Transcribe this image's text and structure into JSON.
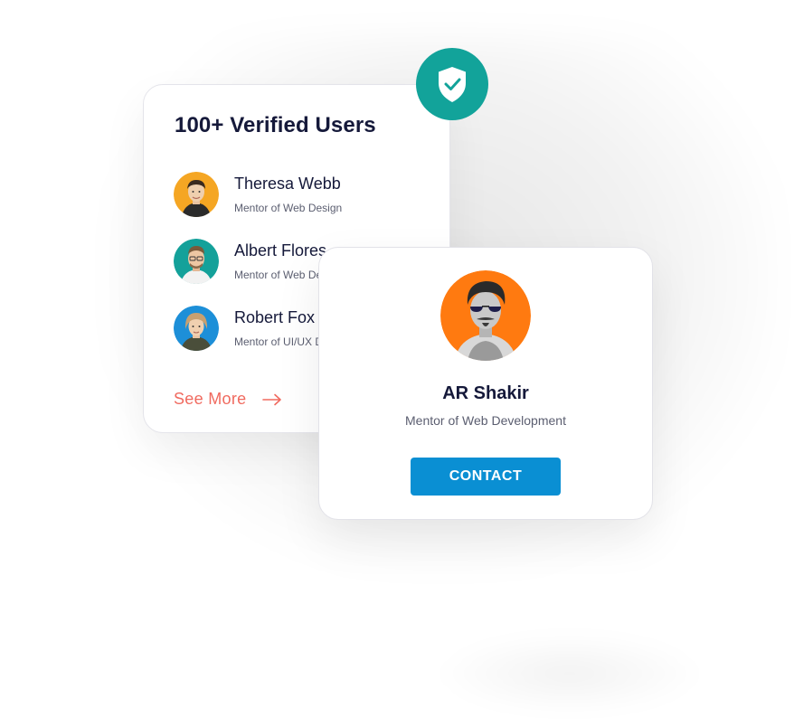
{
  "users_card": {
    "title": "100+ Verified Users",
    "users": [
      {
        "name": "Theresa Webb",
        "role": "Mentor of Web Design"
      },
      {
        "name": "Albert Flores",
        "role": "Mentor of Web Development"
      },
      {
        "name": "Robert Fox",
        "role": "Mentor of UI/UX Design"
      }
    ],
    "see_more_label": "See More"
  },
  "profile_card": {
    "name": "AR Shakir",
    "role": "Mentor of Web Development",
    "contact_label": "CONTACT"
  },
  "icons": {
    "badge": "shield-check-icon",
    "see_more": "arrow-right-icon"
  },
  "colors": {
    "badge_teal": "#12a39a",
    "see_more_coral": "#f06a5f",
    "contact_blue": "#0a8fd3",
    "heading_navy": "#15193a",
    "avatar_orange": "#f5a623",
    "avatar_teal": "#14a19a",
    "avatar_blue": "#1d8fd8",
    "profile_orange": "#ff7a10"
  }
}
